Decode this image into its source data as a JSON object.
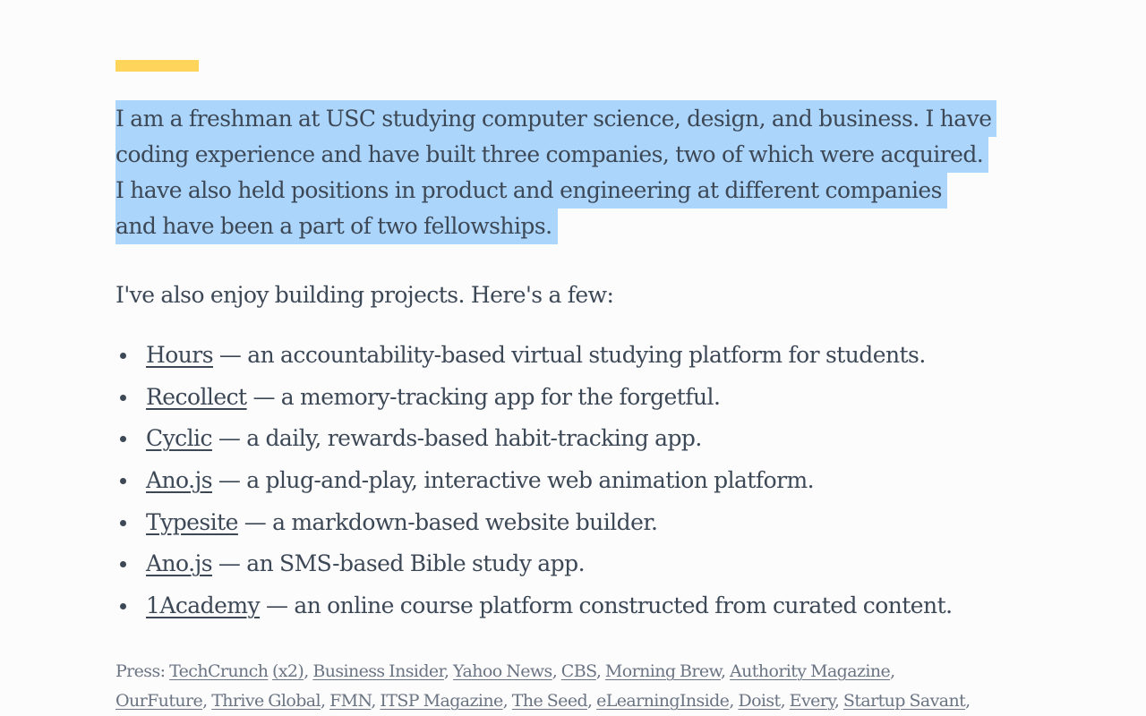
{
  "colors": {
    "accent": "#ffd45b",
    "selection": "#acd5fb",
    "text": "#3d4856",
    "muted_text": "#6b7482",
    "background": "#fcfcfd"
  },
  "intro": {
    "lines": [
      "I am a freshman at USC studying computer science, design, and business. I have",
      "coding experience and have built three companies, two of which were acquired.",
      "I have also held positions in product and engineering at different companies",
      "and have been a part of two fellowships."
    ],
    "selected": true
  },
  "projects_intro": "I've also enjoy building projects. Here's a few:",
  "projects": [
    {
      "name": "Hours",
      "description": " — an accountability-based virtual studying platform for students."
    },
    {
      "name": "Recollect",
      "description": " — a memory-tracking app for the forgetful."
    },
    {
      "name": "Cyclic",
      "description": " — a daily, rewards-based habit-tracking app."
    },
    {
      "name": "Ano.js",
      "description": " — a plug-and-play, interactive web animation platform."
    },
    {
      "name": "Typesite",
      "description": " — a markdown-based website builder."
    },
    {
      "name": "Ano.js",
      "description": " — an SMS-based Bible study app."
    },
    {
      "name": "1Academy",
      "description": " — an online course platform constructed from curated content."
    }
  ],
  "press": {
    "label": "Press: ",
    "links": [
      "TechCrunch",
      "(x2)",
      "Business Insider",
      "Yahoo News",
      "CBS",
      "Morning Brew",
      "Authority Magazine",
      "OurFuture",
      "Thrive Global",
      "FMN",
      "ITSP Magazine",
      "The Seed",
      "eLearningInside",
      "Doist",
      "Every",
      "Startup Savant"
    ]
  }
}
